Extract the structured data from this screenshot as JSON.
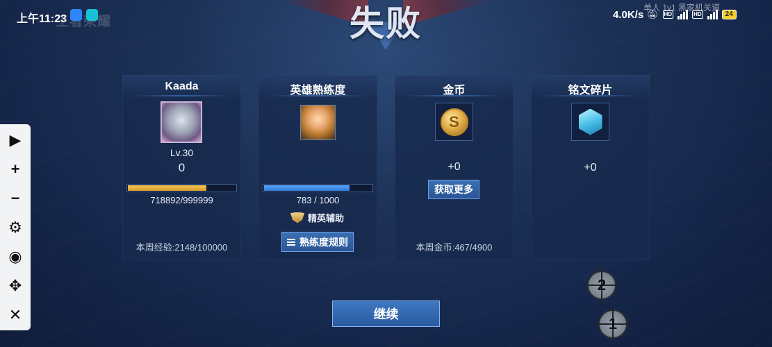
{
  "status_bar": {
    "time": "上午11:23",
    "watermark": "王者荣耀",
    "net_speed": "4.0K/s",
    "network_badges": [
      "HD",
      "4G",
      "HD",
      "4G"
    ],
    "battery": "24",
    "mode_hint": "单人 1v1 黑家机关道"
  },
  "banner": {
    "title": "失败"
  },
  "cards": {
    "player": {
      "title": "Kaada",
      "level": "Lv.30",
      "gain": "0",
      "exp_progress": 0.7189,
      "exp_text": "718892/999999",
      "weekly_exp": "本周经验:2148/100000"
    },
    "hero": {
      "title": "英雄熟练度",
      "mastery_progress": 0.783,
      "mastery_text": "783 / 1000",
      "rank_label": "精英辅助",
      "rules_button": "熟练度规则"
    },
    "gold": {
      "title": "金币",
      "icon": "gold-coin-icon",
      "gain": "+0",
      "more_button": "获取更多",
      "weekly_gold": "本周金币:467/4900"
    },
    "rune": {
      "title": "铭文碎片",
      "icon": "rune-crystal-icon",
      "gain": "+0"
    }
  },
  "continue_button": "继续",
  "toolbar": {
    "items": [
      "play-icon",
      "plus-icon",
      "minus-icon",
      "gear-icon",
      "eye-off-icon",
      "move-icon",
      "close-icon"
    ],
    "glyphs": [
      "▶",
      "+",
      "−",
      "⚙",
      "◉",
      "✥",
      "✕"
    ]
  },
  "markers": [
    "2",
    "1"
  ],
  "colors": {
    "accent": "#3b6fb3",
    "exp_bar": "#f6c65a",
    "mastery_bar": "#5aa8ff",
    "background": "#1d3257"
  }
}
